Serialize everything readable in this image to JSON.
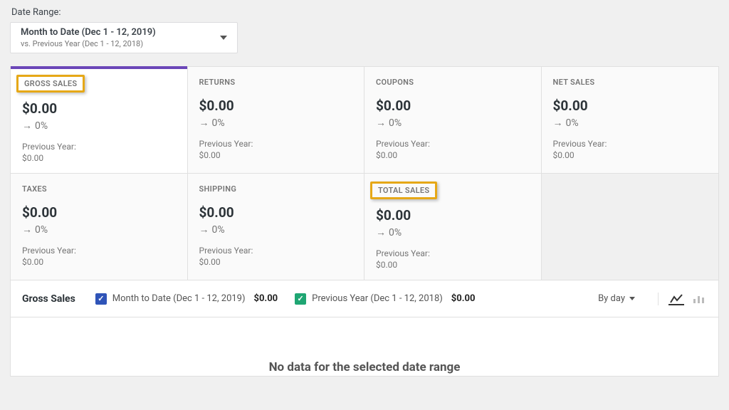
{
  "date_range": {
    "label": "Date Range:",
    "main": "Month to Date (Dec 1 - 12, 2019)",
    "sub": "vs. Previous Year (Dec 1 - 12, 2018)"
  },
  "tabs": [
    {
      "id": "gross-sales",
      "title": "GROSS SALES",
      "value": "$0.00",
      "change": "0%",
      "prev_label": "Previous Year:",
      "prev_value": "$0.00",
      "active": true,
      "highlight": true
    },
    {
      "id": "returns",
      "title": "RETURNS",
      "value": "$0.00",
      "change": "0%",
      "prev_label": "Previous Year:",
      "prev_value": "$0.00"
    },
    {
      "id": "coupons",
      "title": "COUPONS",
      "value": "$0.00",
      "change": "0%",
      "prev_label": "Previous Year:",
      "prev_value": "$0.00"
    },
    {
      "id": "net-sales",
      "title": "NET SALES",
      "value": "$0.00",
      "change": "0%",
      "prev_label": "Previous Year:",
      "prev_value": "$0.00"
    },
    {
      "id": "taxes",
      "title": "TAXES",
      "value": "$0.00",
      "change": "0%",
      "prev_label": "Previous Year:",
      "prev_value": "$0.00"
    },
    {
      "id": "shipping",
      "title": "SHIPPING",
      "value": "$0.00",
      "change": "0%",
      "prev_label": "Previous Year:",
      "prev_value": "$0.00"
    },
    {
      "id": "total-sales",
      "title": "TOTAL SALES",
      "value": "$0.00",
      "change": "0%",
      "prev_label": "Previous Year:",
      "prev_value": "$0.00",
      "highlight": true
    }
  ],
  "legend": {
    "title": "Gross Sales",
    "primary_label": "Month to Date (Dec 1 - 12, 2019)",
    "primary_value": "$0.00",
    "secondary_label": "Previous Year (Dec 1 - 12, 2018)",
    "secondary_value": "$0.00",
    "interval": "By day"
  },
  "chart_area": {
    "no_data": "No data for the selected date range"
  },
  "chart_data": {
    "type": "line",
    "title": "Gross Sales",
    "xlabel": "",
    "ylabel": "",
    "categories": [],
    "series": [
      {
        "name": "Month to Date (Dec 1 - 12, 2019)",
        "values": []
      },
      {
        "name": "Previous Year (Dec 1 - 12, 2018)",
        "values": []
      }
    ],
    "note": "No data for the selected date range"
  }
}
